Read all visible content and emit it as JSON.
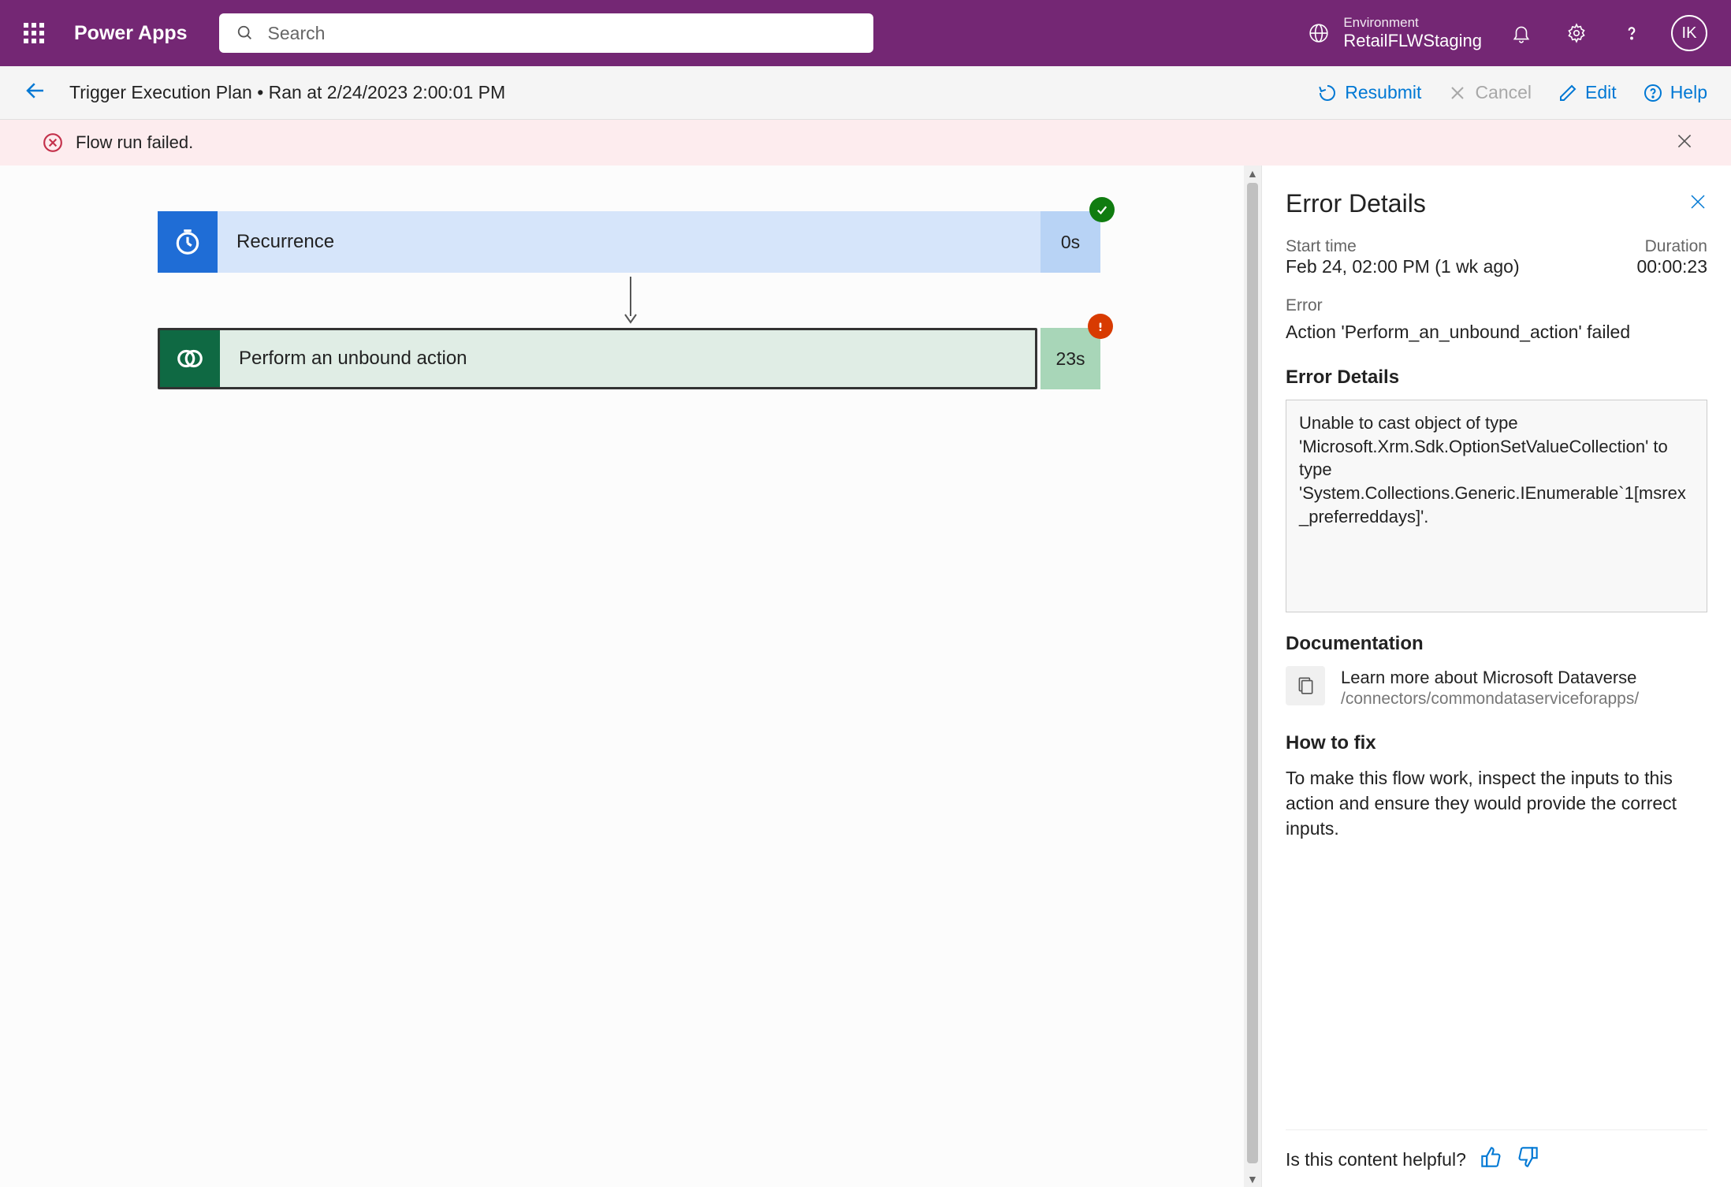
{
  "header": {
    "app_name": "Power Apps",
    "search_placeholder": "Search",
    "env_label": "Environment",
    "env_name": "RetailFLWStaging",
    "avatar_initials": "IK"
  },
  "subheader": {
    "title": "Trigger Execution Plan • Ran at 2/24/2023 2:00:01 PM",
    "resubmit": "Resubmit",
    "cancel": "Cancel",
    "edit": "Edit",
    "help": "Help"
  },
  "banner": {
    "message": "Flow run failed."
  },
  "flow": {
    "recurrence": {
      "label": "Recurrence",
      "time": "0s"
    },
    "action": {
      "label": "Perform an unbound action",
      "time": "23s"
    }
  },
  "panel": {
    "title": "Error Details",
    "start_label": "Start time",
    "start_value": "Feb 24, 02:00 PM (1 wk ago)",
    "duration_label": "Duration",
    "duration_value": "00:00:23",
    "error_label": "Error",
    "error_value": "Action 'Perform_an_unbound_action' failed",
    "details_heading": "Error Details",
    "details_text": "Unable to cast object of type 'Microsoft.Xrm.Sdk.OptionSetValueCollection' to type 'System.Collections.Generic.IEnumerable`1[msrex_preferreddays]'.",
    "doc_heading": "Documentation",
    "doc_link_text": "Learn more about Microsoft Dataverse",
    "doc_path": "/connectors/commondataserviceforapps/",
    "howto_heading": "How to fix",
    "howto_text": "To make this flow work, inspect the inputs to this action and ensure they would provide the correct inputs.",
    "feedback_text": "Is this content helpful?"
  }
}
